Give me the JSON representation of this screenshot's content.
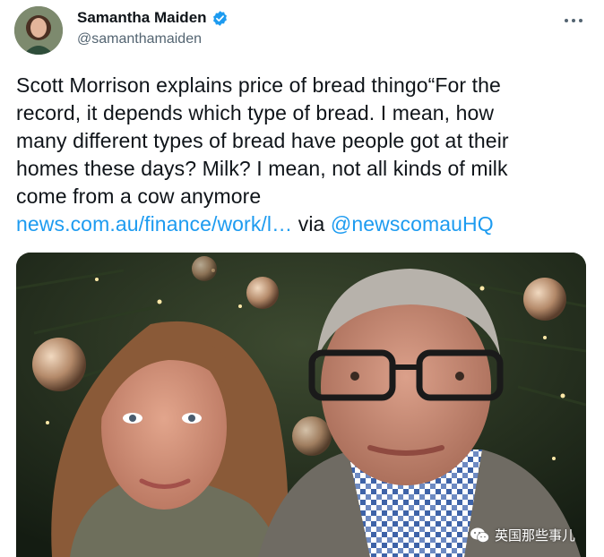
{
  "author": {
    "display_name": "Samantha Maiden",
    "handle": "@samanthamaiden",
    "verified": true,
    "avatar_icon": "profile-photo"
  },
  "menu": {
    "icon": "more-horizontal-icon"
  },
  "tweet": {
    "lines": [
      "Scott Morrison explains price of bread thingo“For the",
      "record, it depends which type of bread. I mean, how",
      "many different types of bread have people got at their",
      "homes these days? Milk? I mean, not all kinds of milk",
      "come from a cow anymore"
    ],
    "link_text": "news.com.au/finance/work/l…",
    "via_text": "via",
    "mention": "@newscomauHQ"
  },
  "media": {
    "image_subject": "photo of two people in front of a decorated christmas tree"
  },
  "watermark": {
    "text": "英国那些事儿",
    "icon": "wechat-icon"
  },
  "colors": {
    "link": "#1d9bf0",
    "text": "#0f1419",
    "secondary": "#536471",
    "verified": "#1d9bf0"
  }
}
